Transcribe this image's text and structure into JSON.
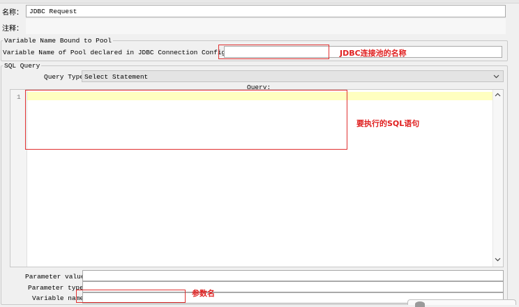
{
  "name_label": "名称：",
  "name_value": "JDBC Request",
  "comment_label": "注释：",
  "pool_section": {
    "title": "Variable Name Bound to Pool",
    "pool_label": "Variable Name of Pool declared in JDBC Connection Configuration:",
    "pool_value": ""
  },
  "sql_section": {
    "title": "SQL Query",
    "query_type_label": "Query Type:",
    "query_type_value": "Select Statement",
    "query_label": "Query:",
    "line_number": "1"
  },
  "params": {
    "values_label": "Parameter values:",
    "types_label": "Parameter types:",
    "names_label": "Variable names:"
  },
  "annotations": {
    "pool_note": "JDBC连接池的名称",
    "sql_note": "要执行的SQL语句",
    "varname_note": "参数名"
  },
  "colors": {
    "annotation_red": "#e02020",
    "highlight_line": "#ffffc0"
  }
}
